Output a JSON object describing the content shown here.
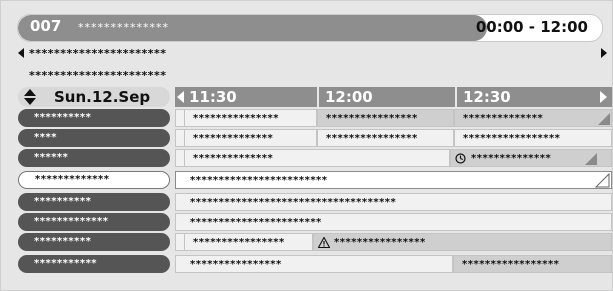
{
  "channel": {
    "number": "007",
    "name": "**************",
    "time_range": "00:00 - 12:00"
  },
  "info": {
    "line1": "**********************",
    "line2": "**********************"
  },
  "grid": {
    "date": "Sun.12.Sep",
    "slots": [
      "11:30",
      "12:00",
      "12:30"
    ]
  },
  "rows": [
    {
      "channel": "**********",
      "programs": [
        "***************",
        "****************",
        "**************"
      ]
    },
    {
      "channel": "****",
      "programs": [
        "**************",
        "****************",
        "*****************"
      ]
    },
    {
      "channel": "******",
      "programs": [
        "**************",
        "**************"
      ]
    },
    {
      "channel": "*************",
      "programs": [
        "************************"
      ]
    },
    {
      "channel": "**********",
      "programs": [
        "************************************"
      ]
    },
    {
      "channel": "*************",
      "programs": [
        "***********************"
      ]
    },
    {
      "channel": "**********",
      "programs": [
        "****************",
        "****************"
      ]
    },
    {
      "channel": "***********",
      "programs": [
        "****************",
        "*****************"
      ]
    }
  ],
  "icons": {
    "clock": "clock-icon",
    "warning": "warning-icon"
  }
}
